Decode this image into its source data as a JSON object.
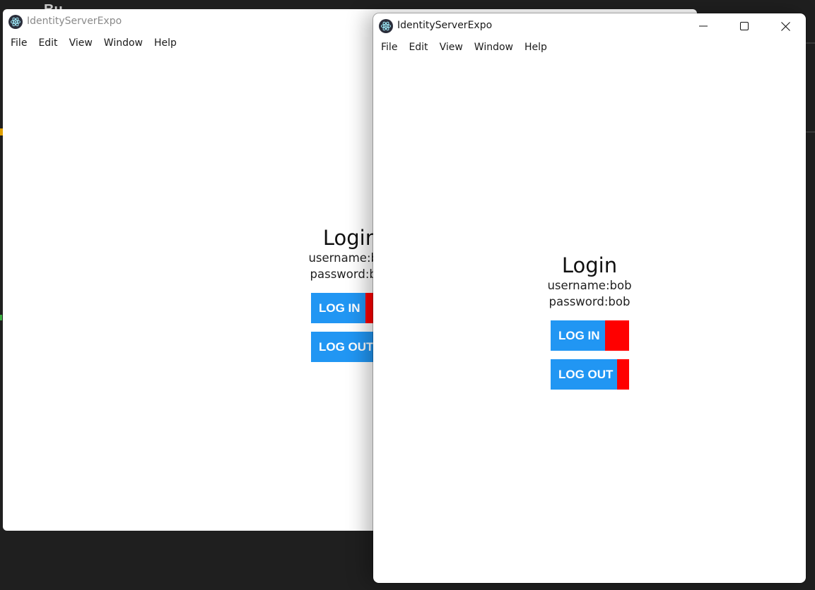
{
  "background": {
    "title_fragment": "Bu"
  },
  "windows": {
    "back": {
      "title": "IdentityServerExpo",
      "menu": [
        "File",
        "Edit",
        "View",
        "Window",
        "Help"
      ],
      "login": {
        "title": "Login",
        "username_line": "username:bob",
        "password_line": "password:bob",
        "login_button": "LOG IN",
        "logout_button": "LOG OUT"
      }
    },
    "front": {
      "title": "IdentityServerExpo",
      "menu": [
        "File",
        "Edit",
        "View",
        "Window",
        "Help"
      ],
      "controls": [
        "minimize-icon",
        "maximize-icon",
        "close-icon"
      ],
      "login": {
        "title": "Login",
        "username_line": "username:bob",
        "password_line": "password:bob",
        "login_button": "LOG IN",
        "logout_button": "LOG OUT"
      }
    }
  },
  "colors": {
    "button_blue": "#2196f3",
    "button_red": "#ff0000",
    "desktop": "#1f1f1f"
  }
}
